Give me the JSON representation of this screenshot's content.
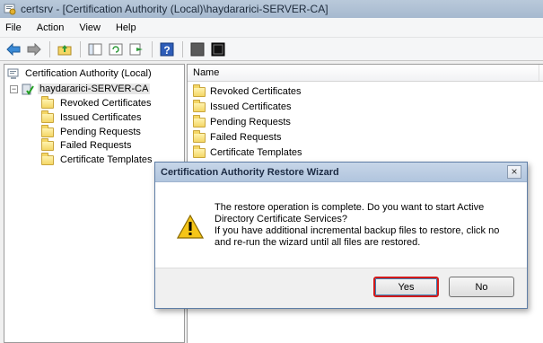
{
  "window": {
    "title": "certsrv - [Certification Authority (Local)\\haydararici-SERVER-CA]"
  },
  "menu": [
    "File",
    "Action",
    "View",
    "Help"
  ],
  "toolbar": {
    "icons": [
      "back-icon",
      "forward-icon",
      "up-folder-icon",
      "show-hide-tree-icon",
      "refresh-icon",
      "export-list-icon",
      "help-icon",
      "stop-service-icon",
      "start-service-icon"
    ]
  },
  "tree": {
    "root": "Certification Authority (Local)",
    "ca": "haydararici-SERVER-CA",
    "expander": "−",
    "items": [
      "Revoked Certificates",
      "Issued Certificates",
      "Pending Requests",
      "Failed Requests",
      "Certificate Templates"
    ]
  },
  "list": {
    "column": "Name",
    "items": [
      "Revoked Certificates",
      "Issued Certificates",
      "Pending Requests",
      "Failed Requests",
      "Certificate Templates"
    ]
  },
  "dialog": {
    "title": "Certification Authority Restore Wizard",
    "close": "×",
    "message_lines": [
      "The restore operation is complete. Do you want to start Active",
      "Directory Certificate Services?",
      "If you have additional incremental backup files to restore, click no",
      "and re-run the wizard until all files are restored."
    ],
    "yes_label": "Yes",
    "no_label": "No"
  },
  "colors": {
    "highlight_border": "#d21a1a",
    "title_bar": "#a6b9cf"
  }
}
